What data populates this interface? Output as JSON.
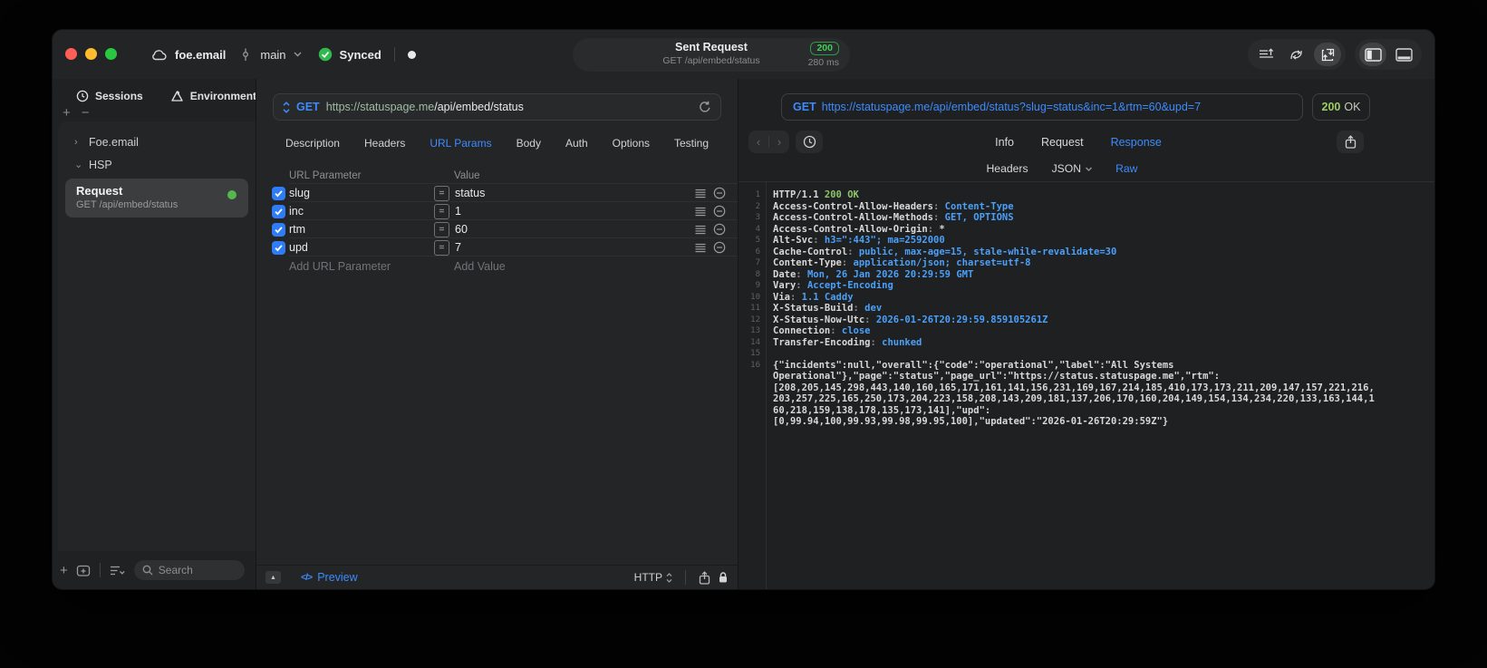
{
  "colors": {
    "accent_blue": "#3d8bfd",
    "status_green": "#3fd158",
    "response_green": "#9ccc65",
    "code_value_blue": "#4aa0fa",
    "checkbox_blue": "#2f7cf7"
  },
  "icons": {
    "plus": "+",
    "minus": "−",
    "chevron_right": "›",
    "chevron_down": "⌄",
    "collapse": "▲",
    "eq": "=",
    "code": "</>",
    "back": "‹",
    "forward": "›"
  },
  "titlebar": {
    "project": "foe.email",
    "branch": "main",
    "sync_status": "Synced",
    "title": "Sent Request",
    "subtitle": "GET /api/embed/status",
    "status_code": "200",
    "duration": "280 ms"
  },
  "sidebar": {
    "tabs": [
      {
        "label": "Sessions"
      },
      {
        "label": "Environments"
      }
    ],
    "tree": [
      {
        "label": "Foe.email"
      },
      {
        "label": "HSP"
      }
    ],
    "request_item": {
      "title": "Request",
      "subtitle": "GET /api/embed/status"
    },
    "search_placeholder": "Search"
  },
  "editor": {
    "method": "GET",
    "url_scheme_host": "https://statuspage.me",
    "url_path": "/api/embed/status",
    "tabs": [
      "Description",
      "Headers",
      "URL Params",
      "Body",
      "Auth",
      "Options",
      "Testing"
    ],
    "active_tab": "URL Params",
    "table": {
      "col_param": "URL Parameter",
      "col_value": "Value",
      "rows": [
        {
          "name": "slug",
          "value": "status",
          "enabled": true
        },
        {
          "name": "inc",
          "value": "1",
          "enabled": true
        },
        {
          "name": "rtm",
          "value": "60",
          "enabled": true
        },
        {
          "name": "upd",
          "value": "7",
          "enabled": true
        }
      ],
      "add_param_label": "Add URL Parameter",
      "add_value_label": "Add Value"
    },
    "footer": {
      "preview_label": "Preview",
      "protocol": "HTTP"
    }
  },
  "response": {
    "method": "GET",
    "url": "https://statuspage.me/api/embed/status?slug=status&inc=1&rtm=60&upd=7",
    "status": "200",
    "status_text": "OK",
    "tabs": [
      "Info",
      "Request",
      "Response"
    ],
    "active_tab": "Response",
    "subtabs": [
      "Headers",
      "JSON",
      "Raw"
    ],
    "active_subtab": "Raw",
    "code_lines": [
      {
        "n": "1",
        "parts": [
          {
            "t": "HTTP/1.1 ",
            "c": "p"
          },
          {
            "t": "200 OK",
            "c": "g"
          }
        ]
      },
      {
        "n": "2",
        "parts": [
          {
            "t": "Access-Control-Allow-Headers",
            "c": "p"
          },
          {
            "t": ": ",
            "c": "d"
          },
          {
            "t": "Content-Type",
            "c": "v"
          }
        ]
      },
      {
        "n": "3",
        "parts": [
          {
            "t": "Access-Control-Allow-Methods",
            "c": "p"
          },
          {
            "t": ": ",
            "c": "d"
          },
          {
            "t": "GET, OPTIONS",
            "c": "v"
          }
        ]
      },
      {
        "n": "4",
        "parts": [
          {
            "t": "Access-Control-Allow-Origin",
            "c": "p"
          },
          {
            "t": ": ",
            "c": "d"
          },
          {
            "t": "*",
            "c": "p"
          }
        ]
      },
      {
        "n": "5",
        "parts": [
          {
            "t": "Alt-Svc",
            "c": "p"
          },
          {
            "t": ": ",
            "c": "d"
          },
          {
            "t": "h3=\":443\"; ma=2592000",
            "c": "v"
          }
        ]
      },
      {
        "n": "6",
        "parts": [
          {
            "t": "Cache-Control",
            "c": "p"
          },
          {
            "t": ": ",
            "c": "d"
          },
          {
            "t": "public, max-age=15, stale-while-revalidate=30",
            "c": "v"
          }
        ]
      },
      {
        "n": "7",
        "parts": [
          {
            "t": "Content-Type",
            "c": "p"
          },
          {
            "t": ": ",
            "c": "d"
          },
          {
            "t": "application/json; charset=utf-8",
            "c": "v"
          }
        ]
      },
      {
        "n": "8",
        "parts": [
          {
            "t": "Date",
            "c": "p"
          },
          {
            "t": ": ",
            "c": "d"
          },
          {
            "t": "Mon, 26 Jan 2026 20:29:59 GMT",
            "c": "v"
          }
        ]
      },
      {
        "n": "9",
        "parts": [
          {
            "t": "Vary",
            "c": "p"
          },
          {
            "t": ": ",
            "c": "d"
          },
          {
            "t": "Accept-Encoding",
            "c": "v"
          }
        ]
      },
      {
        "n": "10",
        "parts": [
          {
            "t": "Via",
            "c": "p"
          },
          {
            "t": ": ",
            "c": "d"
          },
          {
            "t": "1.1 Caddy",
            "c": "v"
          }
        ]
      },
      {
        "n": "11",
        "parts": [
          {
            "t": "X-Status-Build",
            "c": "p"
          },
          {
            "t": ": ",
            "c": "d"
          },
          {
            "t": "dev",
            "c": "v"
          }
        ]
      },
      {
        "n": "12",
        "parts": [
          {
            "t": "X-Status-Now-Utc",
            "c": "p"
          },
          {
            "t": ": ",
            "c": "d"
          },
          {
            "t": "2026-01-26T20:29:59.859105261Z",
            "c": "v"
          }
        ]
      },
      {
        "n": "13",
        "parts": [
          {
            "t": "Connection",
            "c": "p"
          },
          {
            "t": ": ",
            "c": "d"
          },
          {
            "t": "close",
            "c": "v"
          }
        ]
      },
      {
        "n": "14",
        "parts": [
          {
            "t": "Transfer-Encoding",
            "c": "p"
          },
          {
            "t": ": ",
            "c": "d"
          },
          {
            "t": "chunked",
            "c": "v"
          }
        ]
      },
      {
        "n": "15",
        "parts": []
      },
      {
        "n": "16",
        "parts": [
          {
            "t": "{\"incidents\":null,\"overall\":{\"code\":\"operational\",\"label\":\"All Systems",
            "c": "p"
          }
        ]
      },
      {
        "n": "",
        "parts": [
          {
            "t": "Operational\"},\"page\":\"status\",\"page_url\":\"https://status.statuspage.me\",\"rtm\":",
            "c": "p"
          }
        ]
      },
      {
        "n": "",
        "parts": [
          {
            "t": "[208,205,145,298,443,140,160,165,171,161,141,156,231,169,167,214,185,410,173,173,211,209,147,157,221,216,",
            "c": "p"
          }
        ]
      },
      {
        "n": "",
        "parts": [
          {
            "t": "203,257,225,165,250,173,204,223,158,208,143,209,181,137,206,170,160,204,149,154,134,234,220,133,163,144,1",
            "c": "p"
          }
        ]
      },
      {
        "n": "",
        "parts": [
          {
            "t": "60,218,159,138,178,135,173,141],\"upd\":",
            "c": "p"
          }
        ]
      },
      {
        "n": "",
        "parts": [
          {
            "t": "[0,99.94,100,99.93,99.98,99.95,100],\"updated\":\"2026-01-26T20:29:59Z\"}",
            "c": "p"
          }
        ]
      }
    ]
  }
}
